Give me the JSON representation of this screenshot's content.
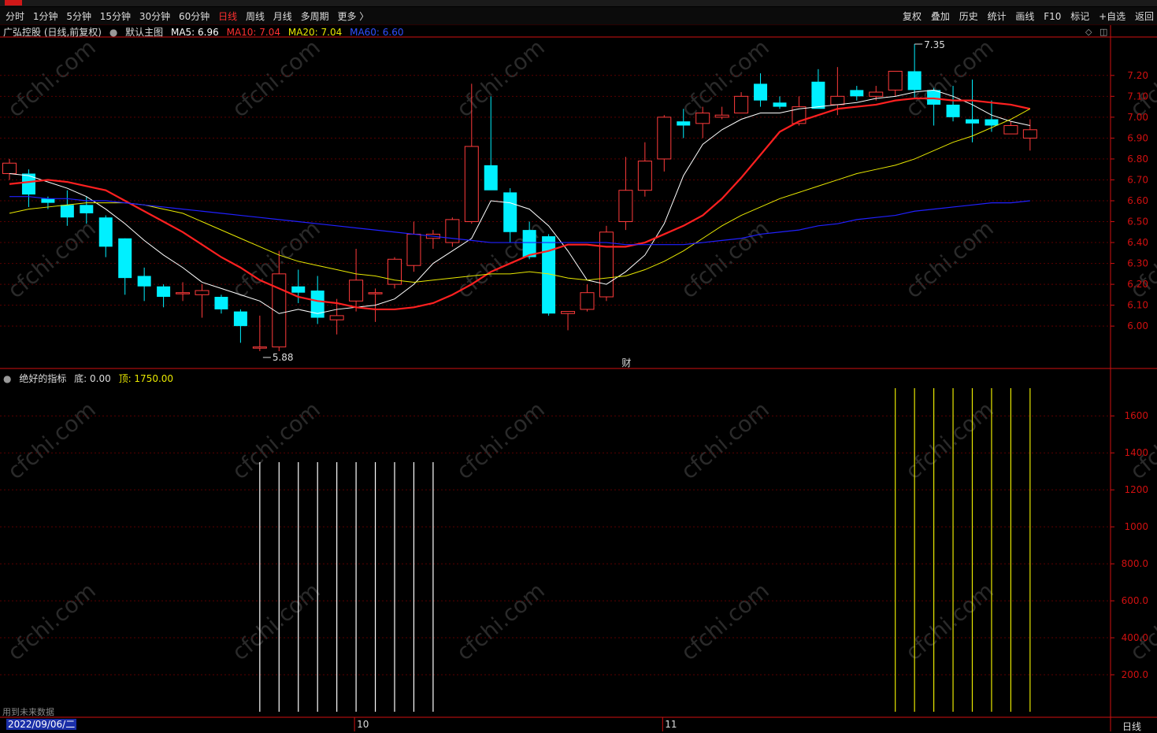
{
  "toolbar": {
    "periods": [
      "分时",
      "1分钟",
      "5分钟",
      "15分钟",
      "30分钟",
      "60分钟",
      "日线",
      "周线",
      "月线",
      "多周期",
      "更多 〉"
    ],
    "active_period": "日线",
    "right_buttons": [
      "复权",
      "叠加",
      "历史",
      "统计",
      "画线",
      "F10",
      "标记",
      "+自选",
      "返回"
    ]
  },
  "main_legend": {
    "stock": "广弘控股 (日线,前复权)",
    "template": "默认主图",
    "ma5": "MA5: 6.96",
    "ma10": "MA10: 7.04",
    "ma20": "MA20: 7.04",
    "ma60": "MA60: 6.60"
  },
  "sub_legend": {
    "name": "绝好的指标",
    "bottom": "底: 0.00",
    "top": "顶: 1750.00"
  },
  "annotations": {
    "high_label": "7.35",
    "low_label": "5.88",
    "finance_marker": "财",
    "future_note": "用到未来数据"
  },
  "bottom_axis": {
    "cursor_date": "2022/09/06/二",
    "month_labels": [
      "10",
      "11"
    ],
    "period": "日线"
  },
  "colors": {
    "up": "#ff3b3b",
    "down": "#00f0ff",
    "ma5": "#ffffff",
    "ma10": "#ff2020",
    "ma20": "#e8e800",
    "ma60": "#2020ff",
    "axis": "#d01010",
    "grid": "#5a0000",
    "watermark": "cfchi.com"
  },
  "chart_data": [
    {
      "type": "candlestick",
      "y_ticks": [
        6.0,
        6.1,
        6.2,
        6.3,
        6.4,
        6.5,
        6.6,
        6.7,
        6.8,
        6.9,
        7.0,
        7.1,
        7.2
      ],
      "ylim": [
        5.88,
        7.35
      ],
      "candles": [
        {
          "o": 6.73,
          "h": 6.8,
          "l": 6.7,
          "c": 6.78
        },
        {
          "o": 6.73,
          "h": 6.75,
          "l": 6.57,
          "c": 6.63
        },
        {
          "o": 6.61,
          "h": 6.62,
          "l": 6.56,
          "c": 6.59
        },
        {
          "o": 6.58,
          "h": 6.65,
          "l": 6.48,
          "c": 6.52
        },
        {
          "o": 6.58,
          "h": 6.62,
          "l": 6.49,
          "c": 6.54
        },
        {
          "o": 6.52,
          "h": 6.53,
          "l": 6.33,
          "c": 6.38
        },
        {
          "o": 6.42,
          "h": 6.42,
          "l": 6.15,
          "c": 6.23
        },
        {
          "o": 6.24,
          "h": 6.28,
          "l": 6.12,
          "c": 6.19
        },
        {
          "o": 6.19,
          "h": 6.2,
          "l": 6.09,
          "c": 6.14
        },
        {
          "o": 6.16,
          "h": 6.21,
          "l": 6.12,
          "c": 6.16
        },
        {
          "o": 6.15,
          "h": 6.2,
          "l": 6.04,
          "c": 6.17
        },
        {
          "o": 6.14,
          "h": 6.15,
          "l": 6.06,
          "c": 6.08
        },
        {
          "o": 6.07,
          "h": 6.08,
          "l": 5.92,
          "c": 6.0
        },
        {
          "o": 5.9,
          "h": 6.05,
          "l": 5.88,
          "c": 5.9
        },
        {
          "o": 5.9,
          "h": 6.36,
          "l": 5.88,
          "c": 6.25
        },
        {
          "o": 6.19,
          "h": 6.27,
          "l": 6.11,
          "c": 6.16
        },
        {
          "o": 6.17,
          "h": 6.24,
          "l": 6.01,
          "c": 6.04
        },
        {
          "o": 6.03,
          "h": 6.13,
          "l": 5.96,
          "c": 6.05
        },
        {
          "o": 6.12,
          "h": 6.37,
          "l": 6.07,
          "c": 6.22
        },
        {
          "o": 6.16,
          "h": 6.18,
          "l": 6.02,
          "c": 6.16
        },
        {
          "o": 6.2,
          "h": 6.33,
          "l": 6.18,
          "c": 6.32
        },
        {
          "o": 6.29,
          "h": 6.5,
          "l": 6.26,
          "c": 6.44
        },
        {
          "o": 6.42,
          "h": 6.46,
          "l": 6.37,
          "c": 6.44
        },
        {
          "o": 6.4,
          "h": 6.52,
          "l": 6.38,
          "c": 6.51
        },
        {
          "o": 6.5,
          "h": 7.16,
          "l": 6.49,
          "c": 6.86
        },
        {
          "o": 6.77,
          "h": 7.1,
          "l": 6.73,
          "c": 6.65
        },
        {
          "o": 6.64,
          "h": 6.66,
          "l": 6.4,
          "c": 6.45
        },
        {
          "o": 6.46,
          "h": 6.5,
          "l": 6.32,
          "c": 6.33
        },
        {
          "o": 6.43,
          "h": 6.44,
          "l": 6.05,
          "c": 6.06
        },
        {
          "o": 6.06,
          "h": 6.07,
          "l": 5.98,
          "c": 6.07
        },
        {
          "o": 6.08,
          "h": 6.2,
          "l": 6.07,
          "c": 6.16
        },
        {
          "o": 6.14,
          "h": 6.48,
          "l": 6.12,
          "c": 6.45
        },
        {
          "o": 6.5,
          "h": 6.81,
          "l": 6.46,
          "c": 6.65
        },
        {
          "o": 6.65,
          "h": 6.88,
          "l": 6.62,
          "c": 6.79
        },
        {
          "o": 6.8,
          "h": 7.01,
          "l": 6.74,
          "c": 7.0
        },
        {
          "o": 6.98,
          "h": 7.04,
          "l": 6.9,
          "c": 6.96
        },
        {
          "o": 6.97,
          "h": 7.05,
          "l": 6.9,
          "c": 7.02
        },
        {
          "o": 7.0,
          "h": 7.05,
          "l": 6.99,
          "c": 7.01
        },
        {
          "o": 7.02,
          "h": 7.12,
          "l": 7.02,
          "c": 7.1
        },
        {
          "o": 7.16,
          "h": 7.21,
          "l": 7.05,
          "c": 7.08
        },
        {
          "o": 7.07,
          "h": 7.1,
          "l": 7.04,
          "c": 7.05
        },
        {
          "o": 6.97,
          "h": 7.1,
          "l": 6.96,
          "c": 7.05
        },
        {
          "o": 7.17,
          "h": 7.23,
          "l": 7.05,
          "c": 7.04
        },
        {
          "o": 7.06,
          "h": 7.24,
          "l": 7.01,
          "c": 7.1
        },
        {
          "o": 7.13,
          "h": 7.15,
          "l": 7.08,
          "c": 7.1
        },
        {
          "o": 7.1,
          "h": 7.15,
          "l": 7.08,
          "c": 7.12
        },
        {
          "o": 7.13,
          "h": 7.22,
          "l": 7.1,
          "c": 7.22
        },
        {
          "o": 7.22,
          "h": 7.35,
          "l": 7.09,
          "c": 7.13
        },
        {
          "o": 7.13,
          "h": 7.14,
          "l": 6.96,
          "c": 7.06
        },
        {
          "o": 7.06,
          "h": 7.15,
          "l": 6.98,
          "c": 7.0
        },
        {
          "o": 6.99,
          "h": 7.18,
          "l": 6.88,
          "c": 6.97
        },
        {
          "o": 6.99,
          "h": 7.08,
          "l": 6.93,
          "c": 6.96
        },
        {
          "o": 6.92,
          "h": 6.98,
          "l": 6.92,
          "c": 6.96
        },
        {
          "o": 6.9,
          "h": 6.99,
          "l": 6.84,
          "c": 6.94
        }
      ],
      "ma_series": [
        {
          "name": "MA5",
          "values": [
            6.73,
            6.72,
            6.69,
            6.66,
            6.62,
            6.56,
            6.49,
            6.41,
            6.34,
            6.28,
            6.21,
            6.18,
            6.15,
            6.12,
            6.06,
            6.08,
            6.06,
            6.08,
            6.09,
            6.1,
            6.13,
            6.2,
            6.3,
            6.36,
            6.42,
            6.6,
            6.59,
            6.56,
            6.48,
            6.36,
            6.22,
            6.2,
            6.26,
            6.34,
            6.49,
            6.72,
            6.87,
            6.94,
            6.99,
            7.02,
            7.02,
            7.04,
            7.05,
            7.06,
            7.07,
            7.09,
            7.1,
            7.12,
            7.13,
            7.1,
            7.06,
            7.01,
            6.98,
            6.96
          ]
        },
        {
          "name": "MA10",
          "values": [
            6.68,
            6.69,
            6.7,
            6.69,
            6.67,
            6.65,
            6.6,
            6.55,
            6.5,
            6.45,
            6.39,
            6.33,
            6.28,
            6.22,
            6.18,
            6.14,
            6.12,
            6.11,
            6.09,
            6.08,
            6.08,
            6.09,
            6.11,
            6.15,
            6.2,
            6.26,
            6.3,
            6.34,
            6.36,
            6.39,
            6.39,
            6.38,
            6.38,
            6.4,
            6.44,
            6.48,
            6.53,
            6.61,
            6.71,
            6.82,
            6.93,
            6.98,
            7.01,
            7.04,
            7.05,
            7.06,
            7.08,
            7.09,
            7.09,
            7.08,
            7.08,
            7.07,
            7.06,
            7.04
          ]
        },
        {
          "name": "MA20",
          "values": [
            6.54,
            6.56,
            6.57,
            6.58,
            6.59,
            6.59,
            6.59,
            6.58,
            6.56,
            6.54,
            6.5,
            6.46,
            6.42,
            6.38,
            6.34,
            6.31,
            6.29,
            6.27,
            6.25,
            6.24,
            6.22,
            6.21,
            6.22,
            6.23,
            6.24,
            6.25,
            6.25,
            6.26,
            6.25,
            6.23,
            6.22,
            6.23,
            6.24,
            6.27,
            6.31,
            6.36,
            6.42,
            6.48,
            6.53,
            6.57,
            6.61,
            6.64,
            6.67,
            6.7,
            6.73,
            6.75,
            6.77,
            6.8,
            6.84,
            6.88,
            6.91,
            6.95,
            6.99,
            7.04
          ]
        },
        {
          "name": "MA60",
          "values": [
            6.62,
            6.62,
            6.61,
            6.61,
            6.6,
            6.6,
            6.59,
            6.58,
            6.57,
            6.56,
            6.55,
            6.54,
            6.53,
            6.52,
            6.51,
            6.5,
            6.49,
            6.48,
            6.47,
            6.46,
            6.45,
            6.44,
            6.43,
            6.42,
            6.41,
            6.4,
            6.4,
            6.4,
            6.4,
            6.4,
            6.4,
            6.4,
            6.39,
            6.39,
            6.39,
            6.39,
            6.4,
            6.41,
            6.42,
            6.44,
            6.45,
            6.46,
            6.48,
            6.49,
            6.51,
            6.52,
            6.53,
            6.55,
            6.56,
            6.57,
            6.58,
            6.59,
            6.59,
            6.6
          ]
        }
      ]
    },
    {
      "type": "bar",
      "y_ticks": [
        200,
        400,
        600,
        800,
        1000,
        1200,
        1400,
        1600
      ],
      "ylim": [
        0,
        1750
      ],
      "bars": [
        {
          "index": 13,
          "value": 1350,
          "color": "white"
        },
        {
          "index": 14,
          "value": 1350,
          "color": "white"
        },
        {
          "index": 15,
          "value": 1350,
          "color": "white"
        },
        {
          "index": 16,
          "value": 1350,
          "color": "white"
        },
        {
          "index": 17,
          "value": 1350,
          "color": "white"
        },
        {
          "index": 18,
          "value": 1350,
          "color": "white"
        },
        {
          "index": 19,
          "value": 1350,
          "color": "white"
        },
        {
          "index": 20,
          "value": 1350,
          "color": "white"
        },
        {
          "index": 21,
          "value": 1350,
          "color": "white"
        },
        {
          "index": 22,
          "value": 1350,
          "color": "white"
        },
        {
          "index": 46,
          "value": 1750,
          "color": "yellow"
        },
        {
          "index": 47,
          "value": 1750,
          "color": "yellow"
        },
        {
          "index": 48,
          "value": 1750,
          "color": "yellow"
        },
        {
          "index": 49,
          "value": 1750,
          "color": "yellow"
        },
        {
          "index": 50,
          "value": 1750,
          "color": "yellow"
        },
        {
          "index": 51,
          "value": 1750,
          "color": "yellow"
        },
        {
          "index": 52,
          "value": 1750,
          "color": "yellow"
        },
        {
          "index": 53,
          "value": 1750,
          "color": "yellow"
        }
      ]
    }
  ]
}
